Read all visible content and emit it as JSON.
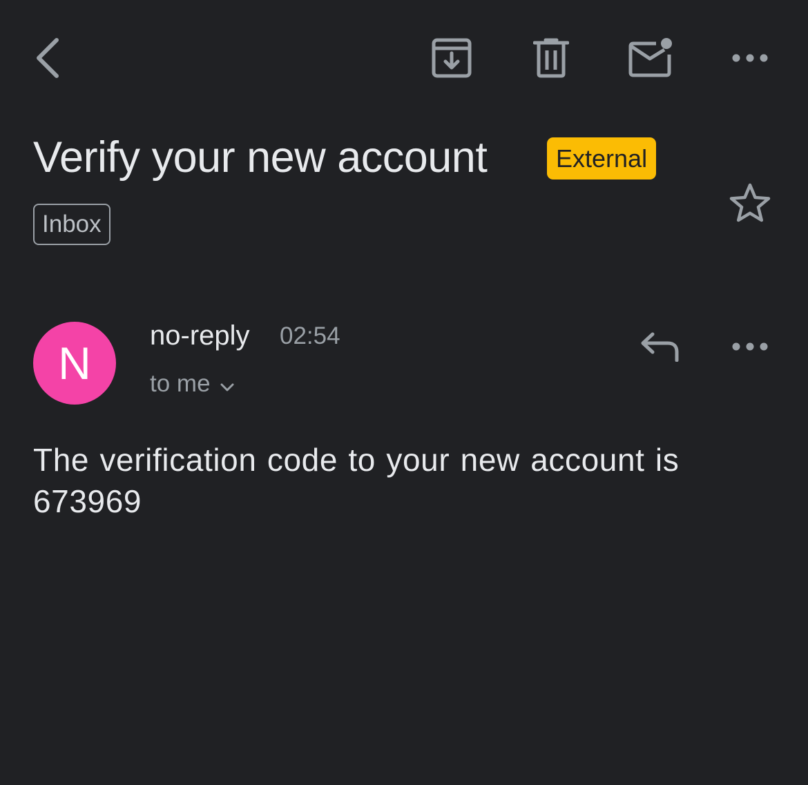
{
  "toolbar": {
    "back_icon": "chevron-left-icon",
    "archive_icon": "archive-icon",
    "delete_icon": "trash-icon",
    "mark_unread_icon": "mail-unread-icon",
    "more_icon": "more-horizontal-icon"
  },
  "email": {
    "subject": "Verify your new account",
    "external_badge": "External",
    "label": "Inbox",
    "star_icon": "star-outline-icon"
  },
  "message": {
    "avatar_letter": "N",
    "sender": "no-reply",
    "time": "02:54",
    "recipients": "to me",
    "reply_icon": "reply-icon",
    "more_icon": "more-horizontal-icon",
    "body": "The verification code to your new account is 673969"
  },
  "colors": {
    "background": "#202124",
    "external_badge": "#fbbc04",
    "avatar": "#f443a7",
    "icon": "#9aa0a6"
  }
}
